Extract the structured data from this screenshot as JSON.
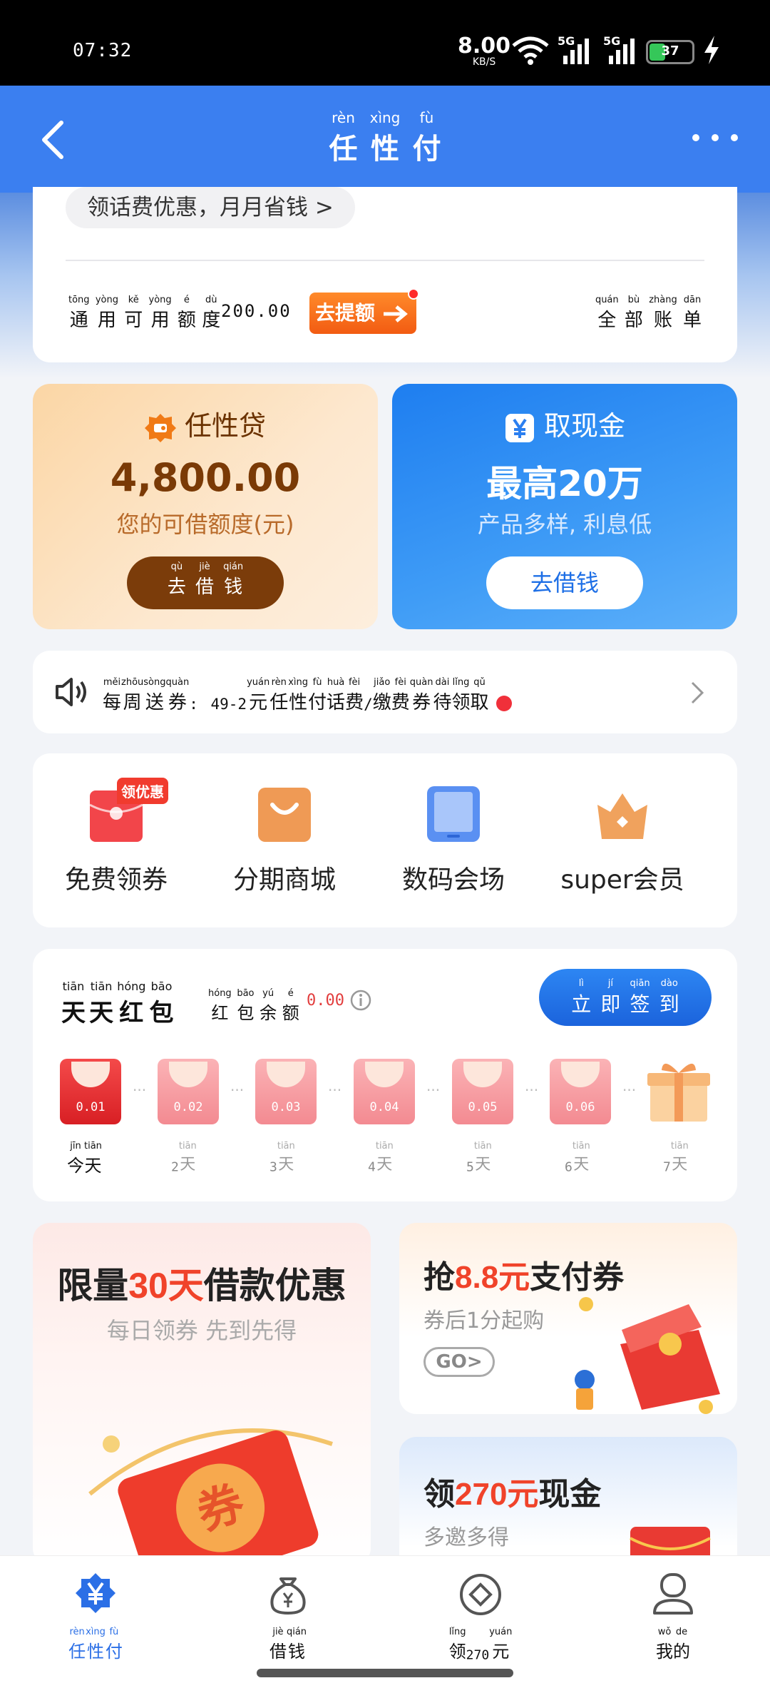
{
  "status_bar": {
    "time": "07:32",
    "speed": "8.00",
    "speed_unit": "KB/S",
    "net1": "5G",
    "net2": "5G",
    "battery": "37"
  },
  "header": {
    "title": [
      {
        "py": "rèn",
        "hz": "任"
      },
      {
        "py": "xìng",
        "hz": "性"
      },
      {
        "py": "fù",
        "hz": "付"
      }
    ]
  },
  "top_card": {
    "promo_pill": "领话费优惠，月月省钱 >",
    "credit_label": [
      {
        "py": "tōng",
        "hz": "通"
      },
      {
        "py": "yòng",
        "hz": "用"
      },
      {
        "py": "kě",
        "hz": "可"
      },
      {
        "py": "yòng",
        "hz": "用"
      },
      {
        "py": "é",
        "hz": "额"
      },
      {
        "py": "dù",
        "hz": "度"
      }
    ],
    "credit_value": "200.00",
    "raise_button": "去提额",
    "all_bills": [
      {
        "py": "quán",
        "hz": "全"
      },
      {
        "py": "bù",
        "hz": "部"
      },
      {
        "py": "zhàng",
        "hz": "账"
      },
      {
        "py": "dān",
        "hz": "单"
      }
    ]
  },
  "loan_card": {
    "name": "任性贷",
    "amount": "4,800.00",
    "subtitle": "您的可借额度(元)",
    "button": [
      {
        "py": "qù",
        "hz": "去"
      },
      {
        "py": "jiè",
        "hz": "借"
      },
      {
        "py": "qián",
        "hz": "钱"
      }
    ]
  },
  "cash_card": {
    "name": "取现金",
    "headline": "最高20万",
    "subtitle": "产品多样, 利息低",
    "button": "去借钱"
  },
  "notice": {
    "label": [
      {
        "py": "měi",
        "hz": "每"
      },
      {
        "py": "zhōu",
        "hz": "周"
      },
      {
        "py": "sòng",
        "hz": "送"
      },
      {
        "py": "quàn",
        "hz": "券"
      }
    ],
    "colon": ":",
    "amount": "49-2",
    "text_a": [
      {
        "py": "yuán",
        "hz": "元"
      },
      {
        "py": "rèn",
        "hz": "任"
      },
      {
        "py": "xìng",
        "hz": "性"
      },
      {
        "py": "fù",
        "hz": "付"
      },
      {
        "py": "huà",
        "hz": "话"
      },
      {
        "py": "fèi",
        "hz": "费"
      }
    ],
    "slash": "/",
    "text_b": [
      {
        "py": "jiǎo",
        "hz": "缴"
      },
      {
        "py": "fèi",
        "hz": "费"
      },
      {
        "py": "quàn",
        "hz": "券"
      },
      {
        "py": "dài",
        "hz": "待"
      },
      {
        "py": "lǐng",
        "hz": "领"
      },
      {
        "py": "qǔ",
        "hz": "取"
      }
    ]
  },
  "quick_grid": [
    {
      "label": "免费领券",
      "badge": "领优惠",
      "icon": "red-envelope-icon"
    },
    {
      "label": "分期商城",
      "icon": "shopping-bag-icon"
    },
    {
      "label": "数码会场",
      "icon": "tablet-icon"
    },
    {
      "label": "super会员",
      "icon": "crown-icon"
    }
  ],
  "red_packets": {
    "title": [
      {
        "py": "tiān",
        "hz": "天"
      },
      {
        "py": "tiān",
        "hz": "天"
      },
      {
        "py": "hóng",
        "hz": "红"
      },
      {
        "py": "bāo",
        "hz": "包"
      }
    ],
    "balance_label": [
      {
        "py": "hóng",
        "hz": "红"
      },
      {
        "py": "bāo",
        "hz": "包"
      },
      {
        "py": "yú",
        "hz": "余"
      },
      {
        "py": "é",
        "hz": "额"
      }
    ],
    "balance": "0.00",
    "signin": [
      {
        "py": "lì",
        "hz": "立"
      },
      {
        "py": "jí",
        "hz": "即"
      },
      {
        "py": "qiān",
        "hz": "签"
      },
      {
        "py": "dào",
        "hz": "到"
      }
    ],
    "packets": [
      "0.01",
      "0.02",
      "0.03",
      "0.04",
      "0.05",
      "0.06"
    ],
    "today": [
      {
        "py": "jīn",
        "hz": "今"
      },
      {
        "py": "tiān",
        "hz": "天"
      }
    ],
    "days": [
      "2",
      "3",
      "4",
      "5",
      "6",
      "7"
    ],
    "day_unit": {
      "py": "tiān",
      "hz": "天"
    }
  },
  "promos": {
    "left": {
      "title_a": "限量",
      "title_accent": "30天",
      "title_b": "借款优惠",
      "subtitle": "每日领券 先到先得"
    },
    "right1": {
      "title_a": "抢",
      "title_accent": "8.8元",
      "title_b": "支付券",
      "subtitle": "券后1分起购",
      "go": "GO>"
    },
    "right2": {
      "title_a": "领",
      "title_accent": "270元",
      "title_b": "现金",
      "subtitle": "多邀多得"
    }
  },
  "bottom_nav": [
    {
      "label": [
        {
          "py": "rèn",
          "hz": "任"
        },
        {
          "py": "xìng",
          "hz": "性"
        },
        {
          "py": "fù",
          "hz": "付"
        }
      ],
      "icon": "yuan-badge-icon",
      "active": true
    },
    {
      "label": [
        {
          "py": "jiè",
          "hz": "借"
        },
        {
          "py": "qián",
          "hz": "钱"
        }
      ],
      "icon": "money-bag-icon"
    },
    {
      "label_a": {
        "py": "lǐng",
        "hz": "领"
      },
      "label_num": "270",
      "label_b": {
        "py": "yuán",
        "hz": "元"
      },
      "icon": "diamond-circle-icon"
    },
    {
      "label": [
        {
          "py": "wǒ",
          "hz": "我"
        },
        {
          "py": "de",
          "hz": "的"
        }
      ],
      "icon": "profile-icon"
    }
  ],
  "colors": {
    "primary": "#3b7ff0",
    "loan_brown": "#7b3c0a",
    "accent_red": "#f0432a"
  }
}
